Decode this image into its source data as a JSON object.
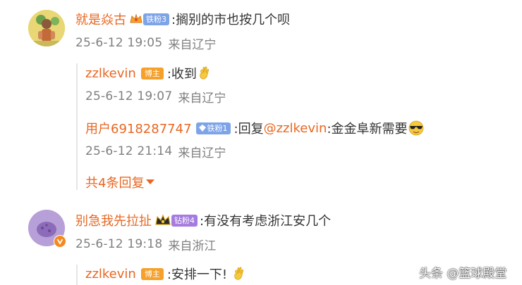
{
  "comments": [
    {
      "user": "就是焱古",
      "badge": "铁粉3",
      "text": ":搁别的市也按几个呗",
      "time": "25-6-12 19:05",
      "location": "来自辽宁",
      "replies": [
        {
          "user": "zzlkevin",
          "badge": "博主",
          "text": ":收到",
          "time": "25-6-12 19:07",
          "location": "来自辽宁"
        },
        {
          "user": "用户6918287747",
          "badge": "铁粉1",
          "text_prefix": ":回复",
          "mention": "@zzlkevin",
          "text_suffix": ":金金阜新需要",
          "time": "25-6-12 21:14",
          "location": "来自辽宁"
        }
      ],
      "more_replies": "共4条回复"
    },
    {
      "user": "别急我先拉扯",
      "badge": "钻粉4",
      "text": ":有没有考虑浙江安几个",
      "time": "25-6-12 19:18",
      "location": "来自浙江",
      "replies": [
        {
          "user": "zzlkevin",
          "badge": "博主",
          "text": ":安排一下!",
          "time": "",
          "location": ""
        }
      ]
    }
  ],
  "watermark": "头条 @篮球殿堂",
  "colors": {
    "username": "#e86722",
    "meta": "#808080",
    "text": "#333333",
    "host_badge": "#f5a02a",
    "iron_badge": "#7ea4e8",
    "diamond_badge": "#a57be0"
  }
}
